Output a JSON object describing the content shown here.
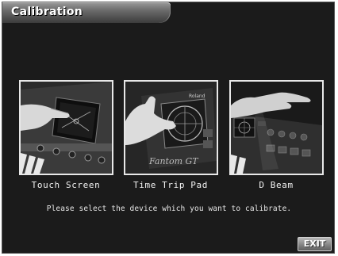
{
  "window": {
    "title": "Calibration"
  },
  "devices": [
    {
      "label": "Touch Screen",
      "image": "touch-screen-photo"
    },
    {
      "label": "Time Trip Pad",
      "image": "time-trip-pad-photo"
    },
    {
      "label": "D Beam",
      "image": "d-beam-photo"
    }
  ],
  "message": "Please select the device which you want to calibrate.",
  "exit_label": "EXIT",
  "colors": {
    "background": "#1b1b1b",
    "card_border": "#e8e8e8",
    "text": "#f2f2f2"
  }
}
